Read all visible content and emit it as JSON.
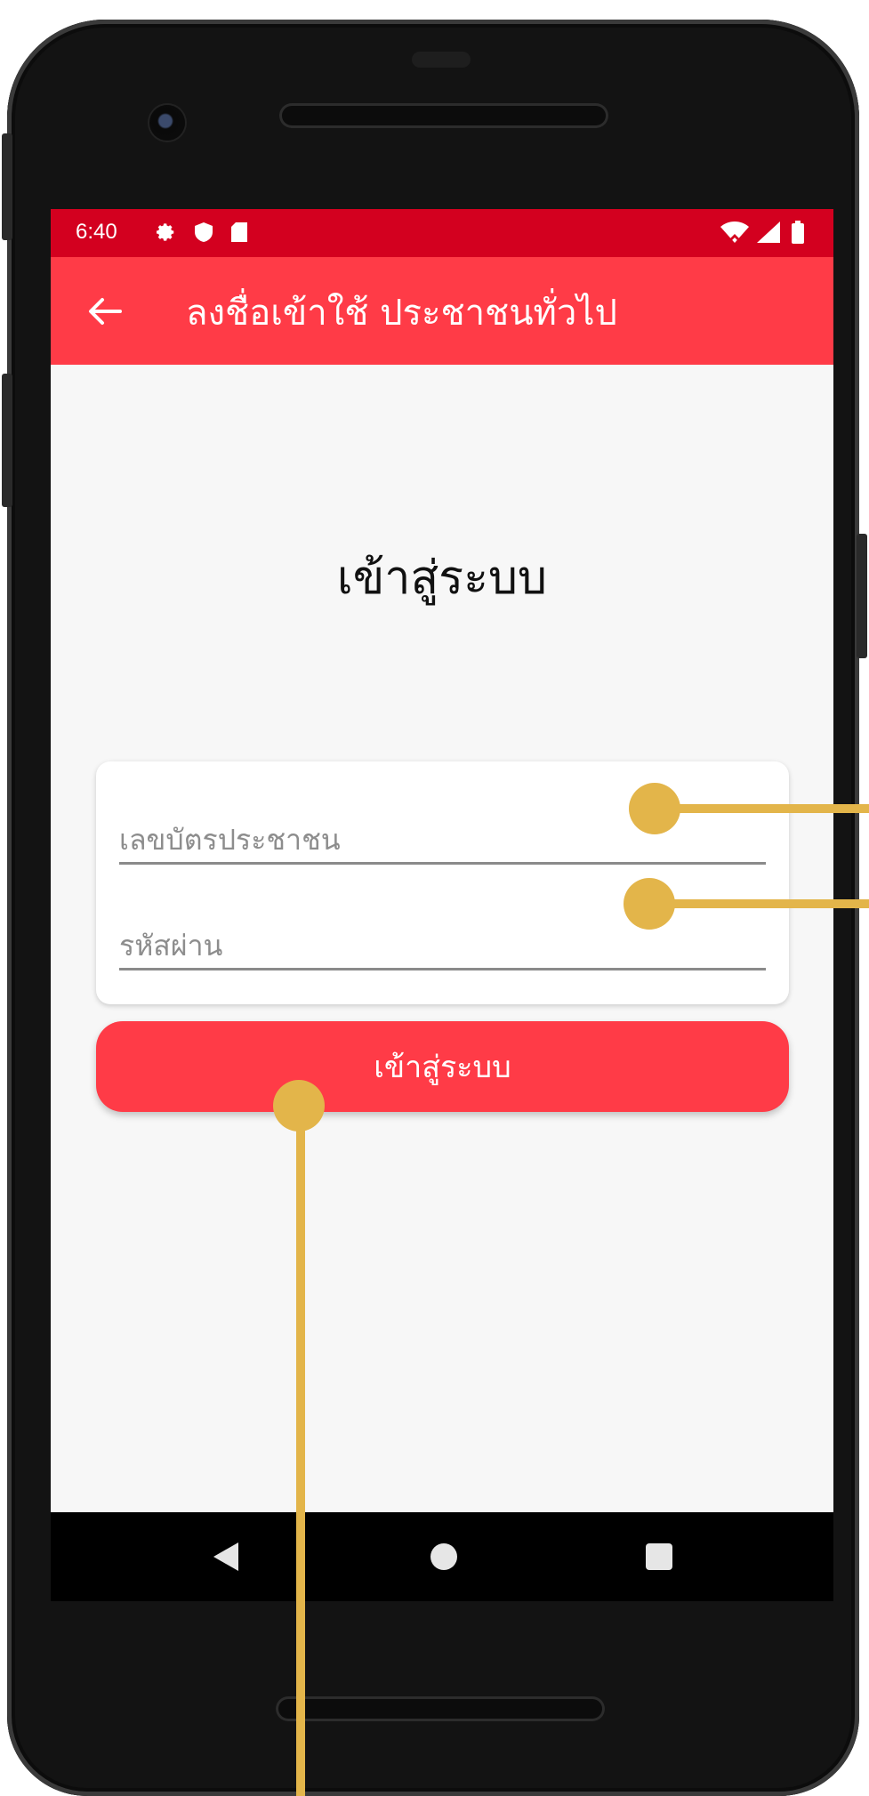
{
  "status_bar": {
    "time": "6:40",
    "icons_left": [
      "gear-icon",
      "shield-icon",
      "sd-card-icon"
    ],
    "icons_right": [
      "wifi-icon",
      "signal-icon",
      "battery-icon"
    ]
  },
  "app_bar": {
    "title": "ลงชื่อเข้าใช้ ประชาชนทั่วไป",
    "back_icon": "arrow-left-icon"
  },
  "login": {
    "heading": "เข้าสู่ระบบ",
    "id_field": {
      "placeholder": "เลขบัตรประชาชน",
      "value": ""
    },
    "password_field": {
      "placeholder": "รหัสผ่าน",
      "value": ""
    },
    "submit_label": "เข้าสู่ระบบ"
  },
  "nav_bar": {
    "buttons": [
      "back-triangle-icon",
      "home-circle-icon",
      "recents-square-icon"
    ]
  },
  "colors": {
    "status_bar": "#d3001f",
    "accent": "#ff3b47",
    "background": "#f7f7f7",
    "callout": "#e3b54a"
  }
}
